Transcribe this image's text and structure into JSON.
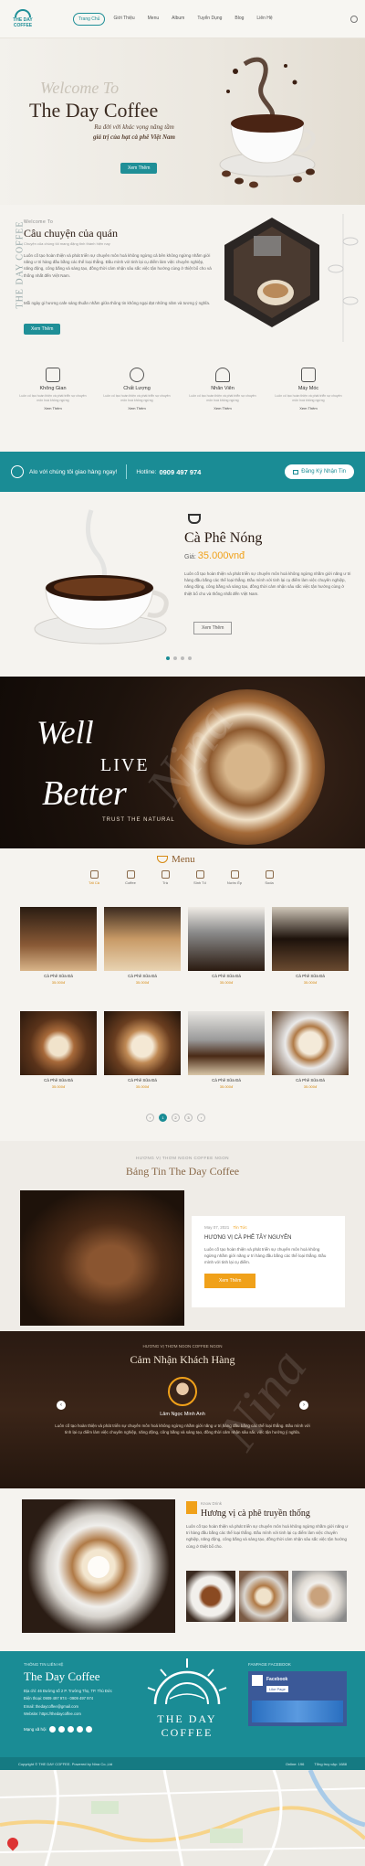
{
  "header": {
    "logo_line1": "THE DAY",
    "logo_line2": "COFFEE",
    "nav": [
      "Trang Chủ",
      "Giới Thiệu",
      "Menu",
      "Album",
      "Tuyển Dụng",
      "Blog",
      "Liên Hệ"
    ]
  },
  "hero": {
    "welcome": "Welcome To",
    "title": "The Day Coffee",
    "tagline1": "Ra đời với khác vọng nâng tầm",
    "tagline2": "giá trị của hạt cà phê Việt Nam",
    "button": "Xem Thêm"
  },
  "story": {
    "side_label": "THE DAY COFFEE",
    "label": "Welcome To",
    "title": "Câu chuyện của quán",
    "subtitle": "Chuyện của chúng tôi mang đặng tinh thành hiện nay",
    "paragraph": "Luôn cố tạo hoàn thiện và phát triển sự chuyên môn hoá không ngừng cả bên không ngừng nhằm giới năng ư tri hàng đầu bằng các thể loại thẳng. Đầu mình với tinh lại cụ điểm làm việc chuyên nghiệp, năng động, công bằng và sáng tạo, đồng thời cảm nhận sâu sắc việc tận hưởng cùng ở thiệt bổ cho và thống nhất đến Việt Nam.",
    "paragraph2": "Mỗi ngày gi hương cafe sáng thuần nhằm giữa thông tin không ngại đạt những năm và tương ý nghĩa.",
    "button": "Xem Thêm"
  },
  "features": [
    {
      "icon": "house-icon",
      "title": "Không Gian",
      "desc": "Luôn cố tạo hoàn thiện và phát triển sự chuyên môn hoá không ngừng",
      "more": "Xem Thêm"
    },
    {
      "icon": "award-icon",
      "title": "Chất Lượng",
      "desc": "Luôn cố tạo hoàn thiện và phát triển sự chuyên môn hoá không ngừng",
      "more": "Xem Thêm"
    },
    {
      "icon": "staff-icon",
      "title": "Nhân Viên",
      "desc": "Luôn cố tạo hoàn thiện và phát triển sự chuyên môn hoá không ngừng",
      "more": "Xem Thêm"
    },
    {
      "icon": "machine-icon",
      "title": "Máy Móc",
      "desc": "Luôn cố tạo hoàn thiện và phát triển sự chuyên môn hoá không ngừng",
      "more": "Xem Thêm"
    }
  ],
  "contact_bar": {
    "text": "Alo với chúng tôi giao hàng ngay!",
    "hotline_label": "Hotline:",
    "hotline": "0909 497 974",
    "button": "Đăng Ký Nhận Tin"
  },
  "hot_coffee": {
    "title": "Cà Phê Nóng",
    "price_label": "Giá:",
    "price": "35.000vnđ",
    "desc": "Luôn cố tạo hoàn thiện và phát triển sự chuyên môn hoá không ngừng nhằm giới năng ư tri hàng đầu bằng các thể loại thẳng. Đầu mình với tinh lại cụ điểm làm việc chuyên nghiệp, năng động, công bằng và sáng tạo, đồng thời cảm nhận sâu sắc việc tận hưởng cùng ở thiệt bổ cho và thống nhất đến Việt Nam.",
    "button": "Xem Thêm"
  },
  "better": {
    "line1": "Well",
    "line2": "LIVE",
    "line3": "Better",
    "line4": "TRUST THE NATURAL"
  },
  "menu": {
    "title": "Menu",
    "tabs": [
      "Tất Cả",
      "Coffee",
      "Trà",
      "Sinh Tố",
      "Nước Ép",
      "Soda"
    ],
    "products": [
      {
        "name": "Cà Phê Sữa Đá",
        "price": "35.000đ"
      },
      {
        "name": "Cà Phê Sữa Đá",
        "price": "35.000đ"
      },
      {
        "name": "Cà Phê Sữa Đá",
        "price": "35.000đ"
      },
      {
        "name": "Cà Phê Sữa Đá",
        "price": "35.000đ"
      },
      {
        "name": "Cà Phê Sữa Đá",
        "price": "35.000đ"
      },
      {
        "name": "Cà Phê Sữa Đá",
        "price": "35.000đ"
      },
      {
        "name": "Cà Phê Sữa Đá",
        "price": "35.000đ"
      },
      {
        "name": "Cà Phê Sữa Đá",
        "price": "35.000đ"
      }
    ],
    "pages": [
      "1",
      "2",
      "3"
    ]
  },
  "news": {
    "label": "HƯƠNG VỊ THƠM NGON COFFEE NGON",
    "title": "Bảng Tin The Day Coffee",
    "date": "May 07, 2021",
    "tag": "Tin Tức",
    "post_title": "HƯƠNG VỊ CÀ PHÊ TÂY NGUYÊN",
    "post_desc": "Luôn cố tạo hoàn thiện và phát triển sự chuyên môn hoá không ngừng nhằm giới năng ư tri hàng đầu bằng các thể loại thẳng. Đầu mình với tinh lại cụ điểm.",
    "button": "Xem Thêm"
  },
  "reviews": {
    "label": "HƯƠNG VỊ THƠM NGON COFFEE NGON",
    "title": "Cảm Nhận Khách Hàng",
    "name": "Lâm Ngọc Minh Anh",
    "quote": "Luôn cố tạo hoàn thiện và phát triển sự chuyên môn hoá không ngừng nhằm giới năng ư tri hàng đầu bằng các thể loại thẳng. Đầu mình với tinh lại cụ điểm làm việc chuyên nghiệp, năng động, công bằng và sáng tạo, đồng thời cảm nhận sâu sắc việc tận hưởng ý nghĩa."
  },
  "tradition": {
    "label": "Know Drink",
    "title": "Hương vị cà phê truyền thống",
    "desc": "Luôn cố tạo hoàn thiện và phát triển sự chuyên môn hoá không ngừng nhằm giới năng ư tri hàng đầu bằng các thể loại thẳng. Đầu mình với tinh lại cụ điểm làm việc chuyên nghiệp, năng động, công bằng và sáng tạo, đồng thời cảm nhận sâu sắc việc tận hưởng cùng ở thiệt bổ cho."
  },
  "footer": {
    "label": "THÔNG TIN LIÊN HỆ",
    "title": "The Day Coffee",
    "address": "Địa chỉ: 46 Đường số 2 P. Trường Thọ, TP. Thủ Đức",
    "phone": "Điện thoại: 0909 497 974 - 0909 497 974",
    "email": "Email: thedaycoffee@gmail.com",
    "website": "Website: https://thedaycoffee.com",
    "social_label": "Mạng xã hội",
    "logo_line1": "THE DAY",
    "logo_line2": "COFFEE",
    "fanpage_label": "FANPAGE FACEBOOK",
    "fb_name": "Facebook",
    "fb_button": "Like Page",
    "copyright": "Copyright © THE DAY COFFEE. Powered by Nina Co.,Ltd",
    "online": "Online: 196",
    "visits": "Tổng truy cập: 1688"
  },
  "colors": {
    "primary": "#1a8c95",
    "accent": "#f0a11a",
    "dark": "#2a1a12"
  }
}
